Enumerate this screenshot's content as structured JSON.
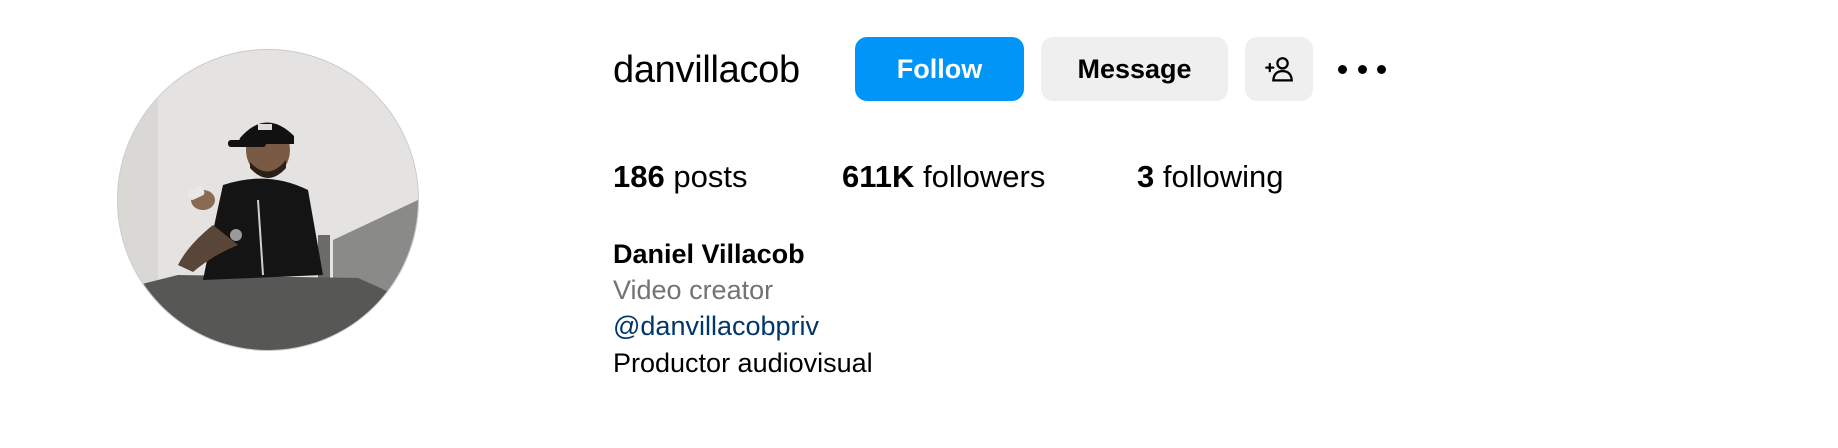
{
  "profile": {
    "username": "danvillacob",
    "full_name": "Daniel Villacob",
    "category": "Video creator",
    "linked_account": "@danvillacobpriv",
    "bio": "Productor audiovisual"
  },
  "actions": {
    "follow_label": "Follow",
    "message_label": "Message",
    "add_user_icon": "person-add-icon",
    "more_icon": "more-horizontal-icon"
  },
  "stats": {
    "posts": {
      "count": "186",
      "label": "posts"
    },
    "followers": {
      "count": "611K",
      "label": "followers"
    },
    "following": {
      "count": "3",
      "label": "following"
    }
  },
  "colors": {
    "follow_button": "#0095f6",
    "secondary_button": "#efefef",
    "category_text": "#737373",
    "link_text": "#00376b"
  }
}
